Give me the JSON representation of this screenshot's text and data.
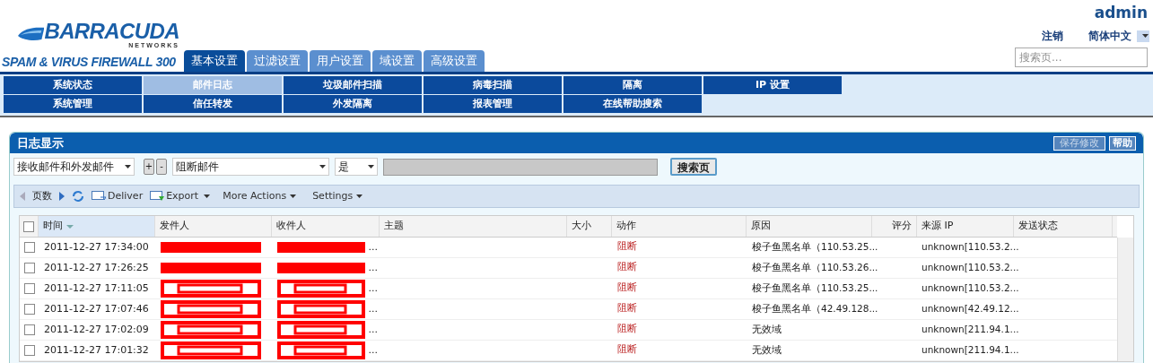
{
  "logo": {
    "brand": "BARRACUDA",
    "sub": "NETWORKS",
    "product": "SPAM & VIRUS FIREWALL 300"
  },
  "user": {
    "name": "admin",
    "logout": "注销",
    "language": "简体中文",
    "search_placeholder": "搜索页..."
  },
  "tabs": [
    {
      "label": "基本设置",
      "selected": true
    },
    {
      "label": "过滤设置",
      "selected": false
    },
    {
      "label": "用户设置",
      "selected": false
    },
    {
      "label": "域设置",
      "selected": false
    },
    {
      "label": "高级设置",
      "selected": false
    }
  ],
  "subnav": [
    [
      {
        "label": "系统状态",
        "selected": false
      },
      {
        "label": "邮件日志",
        "selected": true
      },
      {
        "label": "垃圾邮件扫描",
        "selected": false
      },
      {
        "label": "病毒扫描",
        "selected": false
      },
      {
        "label": "隔离",
        "selected": false
      },
      {
        "label": "IP 设置",
        "selected": false
      }
    ],
    [
      {
        "label": "系统管理",
        "selected": false
      },
      {
        "label": "信任转发",
        "selected": false
      },
      {
        "label": "外发隔离",
        "selected": false
      },
      {
        "label": "报表管理",
        "selected": false
      },
      {
        "label": "在线帮助搜索",
        "selected": false
      }
    ]
  ],
  "panel": {
    "title": "日志显示",
    "save": "保存修改",
    "help": "帮助"
  },
  "filters": {
    "scope": "接收邮件和外发邮件",
    "plus": "+",
    "minus": "-",
    "field": "阻断邮件",
    "op": "是",
    "search": "搜索页"
  },
  "toolbar": {
    "page": "页数",
    "deliver": "Deliver",
    "export": "Export",
    "more": "More Actions",
    "settings": "Settings"
  },
  "select_all": {
    "checked": false
  },
  "columns": [
    "时间",
    "发件人",
    "收件人",
    "主题",
    "大小",
    "动作",
    "原因",
    "评分",
    "来源 IP",
    "发送状态"
  ],
  "rows": [
    {
      "checked": false,
      "time": "2011-12-27 17:34:00",
      "sender": {
        "kind": "bar"
      },
      "recipient": {
        "kind": "bar",
        "text": "..."
      },
      "action": "阻断",
      "reason": "梭子鱼黑名单（110.53.25...",
      "ip": "unknown[110.53.2..."
    },
    {
      "checked": false,
      "time": "2011-12-27 17:26:25",
      "sender": {
        "kind": "bar"
      },
      "recipient": {
        "kind": "bar",
        "text": "..."
      },
      "action": "阻断",
      "reason": "梭子鱼黑名单（110.53.26...",
      "ip": "unknown[110.53.2..."
    },
    {
      "checked": false,
      "time": "2011-12-27 17:11:05",
      "sender": {
        "kind": "boxes"
      },
      "recipient": {
        "kind": "boxes",
        "text": "..."
      },
      "action": "阻断",
      "reason": "梭子鱼黑名单（110.53.25...",
      "ip": "unknown[110.53.2..."
    },
    {
      "checked": false,
      "time": "2011-12-27 17:07:46",
      "sender": {
        "kind": "boxes"
      },
      "recipient": {
        "kind": "boxes",
        "text": "..."
      },
      "action": "阻断",
      "reason": "梭子鱼黑名单（42.49.128...",
      "ip": "unknown[42.49.12..."
    },
    {
      "checked": false,
      "time": "2011-12-27 17:02:09",
      "sender": {
        "kind": "boxes"
      },
      "recipient": {
        "kind": "boxes",
        "text": "..."
      },
      "action": "阻断",
      "reason": "无效域",
      "ip": "unknown[211.94.1..."
    },
    {
      "checked": false,
      "time": "2011-12-27 17:01:32",
      "sender": {
        "kind": "boxes"
      },
      "recipient": {
        "kind": "boxes",
        "text": "..."
      },
      "action": "阻断",
      "reason": "无效域",
      "ip": "unknown[211.94.1..."
    }
  ]
}
